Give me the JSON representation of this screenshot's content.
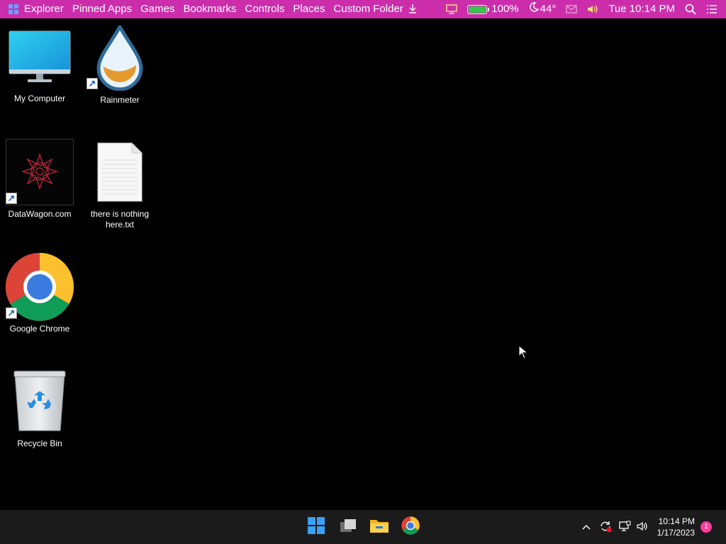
{
  "menubar": {
    "items": [
      "Explorer",
      "Pinned Apps",
      "Games",
      "Bookmarks",
      "Controls",
      "Places",
      "Custom Folder"
    ],
    "battery": "100%",
    "battery_level": 1.0,
    "weather": "44°",
    "datetime": "Tue 10:14 PM",
    "colors": {
      "bar": "#cc2eab",
      "battery_fill": "#35c84a"
    }
  },
  "desktop": {
    "icons": [
      {
        "label": "My Computer",
        "icon": "monitor-icon"
      },
      {
        "label": "Rainmeter",
        "icon": "rainmeter-drop-icon"
      },
      {
        "label": "DataWagon.com",
        "icon": "datawagon-logo-icon"
      },
      {
        "label": "there is nothing here.txt",
        "icon": "text-file-icon"
      },
      {
        "label": "Google Chrome",
        "icon": "chrome-icon"
      },
      {
        "label": "Recycle Bin",
        "icon": "recycle-bin-icon"
      }
    ]
  },
  "taskbar": {
    "apps": [
      "start-icon",
      "task-view-icon",
      "file-explorer-icon",
      "chrome-icon"
    ],
    "time": "10:14 PM",
    "date": "1/17/2023",
    "notification_count": "1"
  }
}
